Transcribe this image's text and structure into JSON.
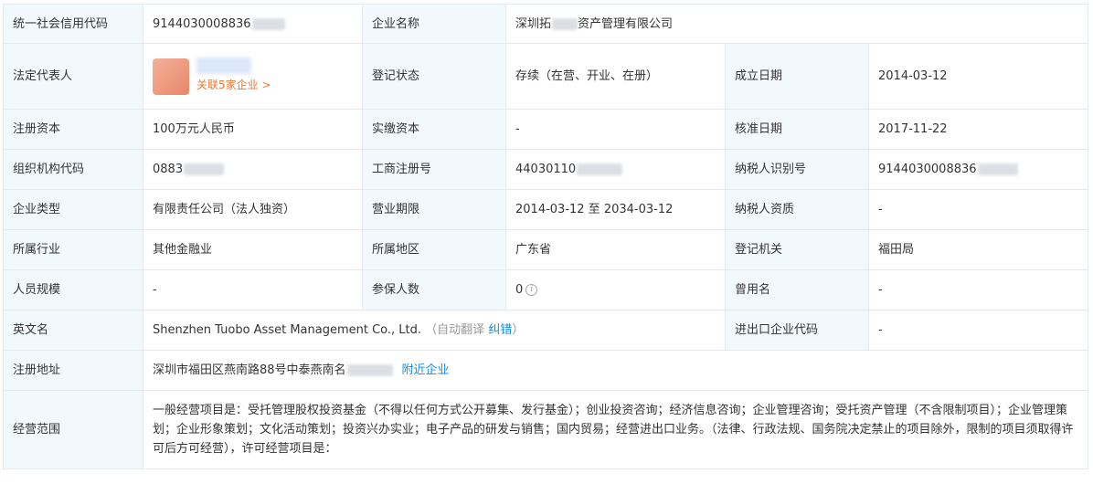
{
  "rows": {
    "r1": {
      "k1": "统一社会信用代码",
      "v1": "9144030008836",
      "k2": "企业名称",
      "v2a": "深圳拓",
      "v2b": "资产管理有限公司"
    },
    "r2": {
      "k1": "法定代表人",
      "related": "关联5家企业 >",
      "k2": "登记状态",
      "v2": "存续（在营、开业、在册）",
      "k3": "成立日期",
      "v3": "2014-03-12"
    },
    "r3": {
      "k1": "注册资本",
      "v1": "100万元人民币",
      "k2": "实缴资本",
      "v2": "-",
      "k3": "核准日期",
      "v3": "2017-11-22"
    },
    "r4": {
      "k1": "组织机构代码",
      "v1": "0883",
      "k2": "工商注册号",
      "v2": "44030110",
      "k3": "纳税人识别号",
      "v3": "9144030008836"
    },
    "r5": {
      "k1": "企业类型",
      "v1": "有限责任公司（法人独资）",
      "k2": "营业期限",
      "v2": "2014-03-12 至 2034-03-12",
      "k3": "纳税人资质",
      "v3": "-"
    },
    "r6": {
      "k1": "所属行业",
      "v1": "其他金融业",
      "k2": "所属地区",
      "v2": "广东省",
      "k3": "登记机关",
      "v3": "福田局"
    },
    "r7": {
      "k1": "人员规模",
      "v1": "-",
      "k2": "参保人数",
      "v2": "0",
      "k3": "曾用名",
      "v3": "-"
    },
    "r8": {
      "k1": "英文名",
      "v1": "Shenzhen Tuobo Asset Management Co., Ltd.",
      "auto_open": "（自动翻译 ",
      "correct": "纠错",
      "auto_close": "）",
      "k3": "进出口企业代码",
      "v3": "-"
    },
    "r9": {
      "k1": "注册地址",
      "v1": "深圳市福田区燕南路88号中泰燕南名",
      "nearby": "附近企业"
    },
    "r10": {
      "k1": "经营范围",
      "v1": "一般经营项目是：受托管理股权投资基金（不得以任何方式公开募集、发行基金）；创业投资咨询；经济信息咨询；企业管理咨询；受托资产管理（不含限制项目）；企业管理策划；企业形象策划；文化活动策划；投资兴办实业；电子产品的研发与销售；国内贸易；经营进出口业务。（法律、行政法规、国务院决定禁止的项目除外，限制的项目须取得许可后方可经营），许可经营项目是："
    }
  },
  "colors": {
    "label_bg": "#f2f9fc",
    "border": "#e4eaf2",
    "link_blue": "#128bed",
    "link_orange": "#f2762e"
  },
  "icons": {
    "info": "info-circle-icon"
  }
}
